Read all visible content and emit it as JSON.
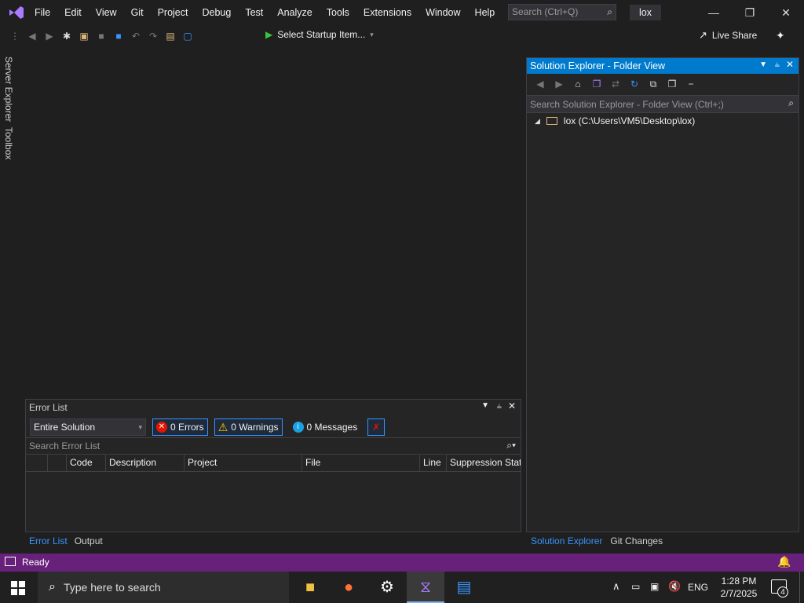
{
  "menu": {
    "items": [
      "File",
      "Edit",
      "View",
      "Git",
      "Project",
      "Debug",
      "Test",
      "Analyze",
      "Tools",
      "Extensions",
      "Window",
      "Help"
    ],
    "search_placeholder": "Search (Ctrl+Q)",
    "solution_name": "lox"
  },
  "toolbar": {
    "start_label": "Select Startup Item...",
    "live_share": "Live Share"
  },
  "left_strip": {
    "tabs": [
      "Server Explorer",
      "Toolbox"
    ]
  },
  "error_list": {
    "title": "Error List",
    "scope": "Entire Solution",
    "errors": "0 Errors",
    "warnings": "0 Warnings",
    "messages": "0 Messages",
    "search_placeholder": "Search Error List",
    "columns": [
      "Code",
      "Description",
      "Project",
      "File",
      "Line",
      "Suppression State"
    ],
    "tabs": [
      "Error List",
      "Output"
    ]
  },
  "solution_explorer": {
    "title": "Solution Explorer - Folder View",
    "search_placeholder": "Search Solution Explorer - Folder View (Ctrl+;)",
    "root_item": "lox (C:\\Users\\VM5\\Desktop\\lox)",
    "tabs": [
      "Solution Explorer",
      "Git Changes"
    ]
  },
  "status": {
    "text": "Ready"
  },
  "taskbar": {
    "search_placeholder": "Type here to search",
    "language": "ENG",
    "time": "1:28 PM",
    "date": "2/7/2025",
    "notification_count": "4"
  },
  "colors": {
    "accent": "#007acc",
    "status_bar": "#68217a",
    "vs_purple": "#a97bff"
  }
}
